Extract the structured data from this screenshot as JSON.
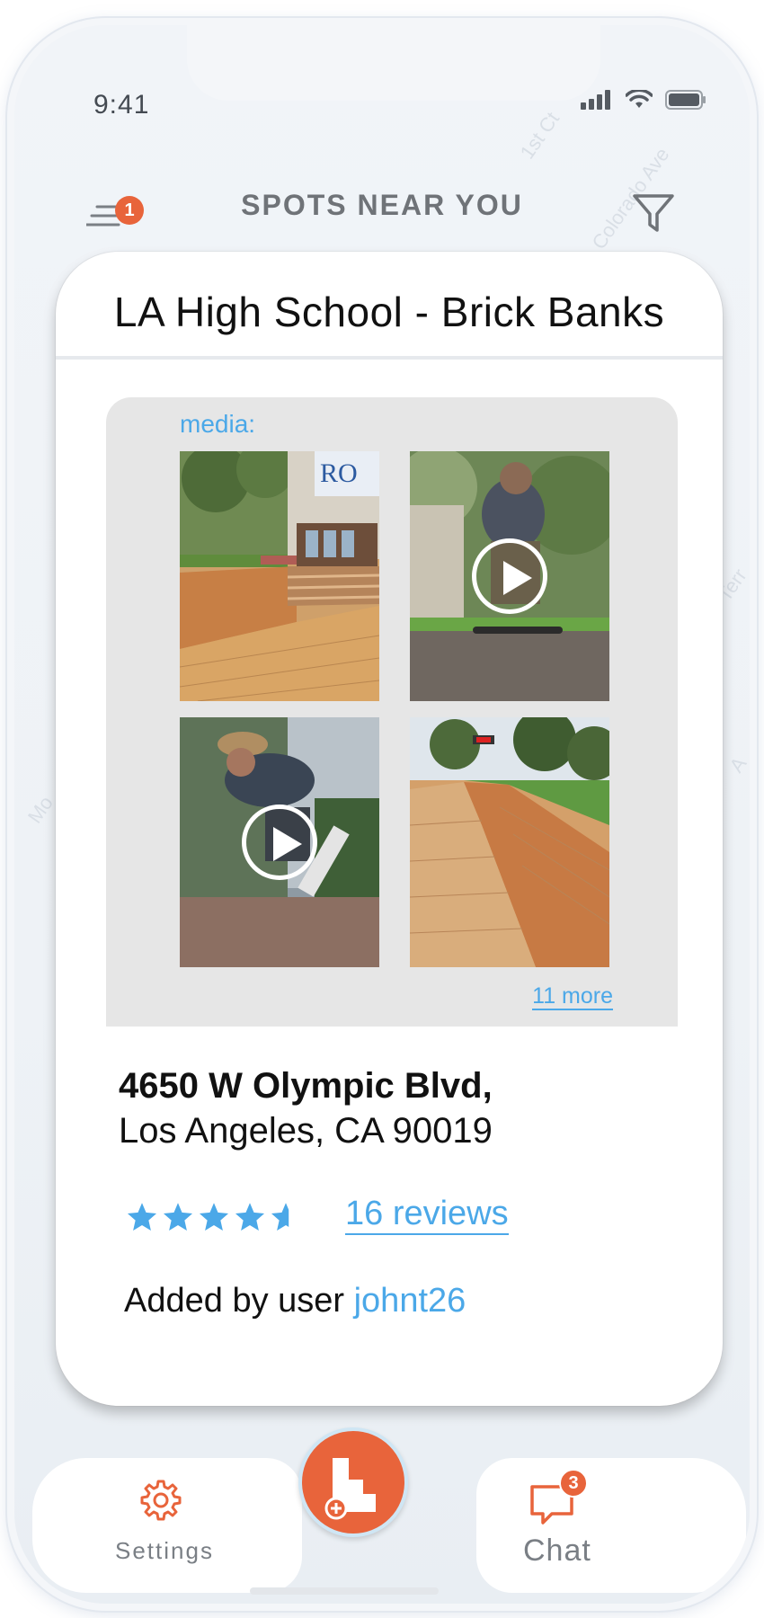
{
  "status_bar": {
    "time": "9:41"
  },
  "header": {
    "title": "SPOTS NEAR YOU",
    "menu_badge": "1"
  },
  "map_labels": [
    "1st Ct",
    "Colorado Ave",
    "Terr",
    "Mo",
    "A"
  ],
  "spot": {
    "title": "LA High School - Brick Banks",
    "media_label": "media:",
    "media": [
      {
        "kind": "photo",
        "icon": "brick-steps-photo"
      },
      {
        "kind": "video",
        "icon": "play-icon"
      },
      {
        "kind": "video",
        "icon": "play-icon"
      },
      {
        "kind": "photo",
        "icon": "brick-bank-photo"
      }
    ],
    "more_label": "11 more",
    "address_line1": "4650 W Olympic Blvd,",
    "address_line2": "Los Angeles, CA 90019",
    "rating": 4.5,
    "rating_max": 5,
    "reviews_label": "16 reviews",
    "added_by_prefix": "Added by user ",
    "added_by_user": "johnt26"
  },
  "tabbar": {
    "settings_label": "Settings",
    "chat_label": "Chat",
    "chat_badge": "3"
  },
  "colors": {
    "accent": "#e8643b",
    "link": "#4ba8e8",
    "star": "#4ba8e8"
  }
}
